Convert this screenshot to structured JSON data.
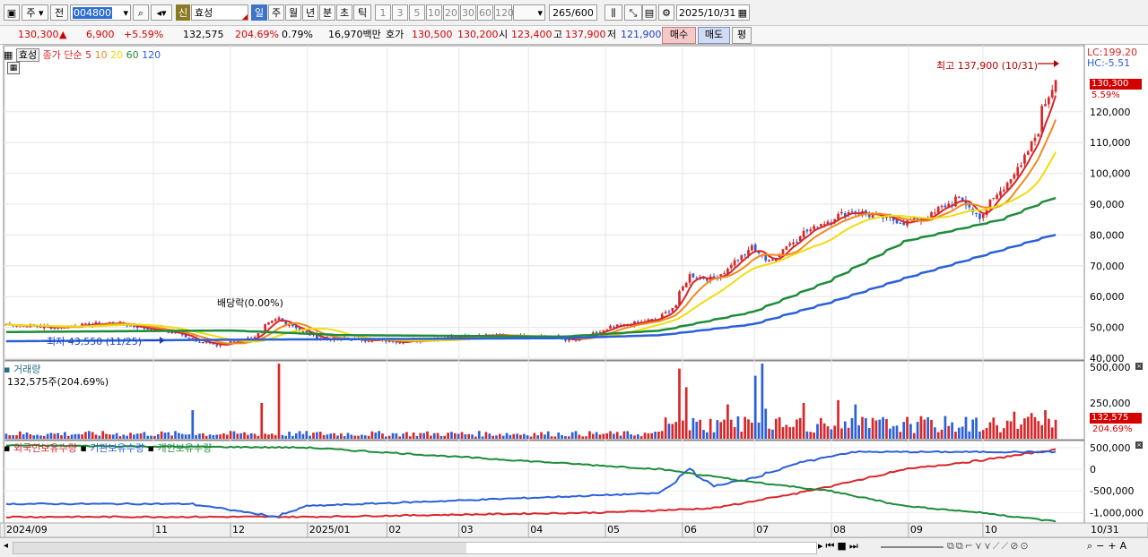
{
  "toolbar": {
    "period_week": "주",
    "prev": "전",
    "code": "004800",
    "stock_name": "효성",
    "badge_new": "신",
    "tabs": [
      "일",
      "주",
      "월",
      "년",
      "분",
      "초",
      "틱"
    ],
    "intervals": [
      "1",
      "3",
      "5",
      "10",
      "20",
      "30",
      "60",
      "120"
    ],
    "count_current": "265",
    "count_max": "/600",
    "date": "2025/10/31"
  },
  "quote": {
    "price": "130,300",
    "arrow": "▲",
    "change": "6,900",
    "change_pct": "+5.59%",
    "volume": "132,575",
    "volume_ratio": "204.69%",
    "turnover_rate": "0.79%",
    "amount": "16,970백만",
    "ask_label": "호가",
    "ask": "130,500",
    "bid": "130,200",
    "open_label": "시",
    "open": "123,400",
    "high_label": "고",
    "high": "137,900",
    "low_label": "저",
    "low": "121,900",
    "buy": "매수",
    "sell": "매도",
    "avg": "평"
  },
  "price_panel": {
    "name_box": "효성",
    "legend_prefix": "종가 단순",
    "ma_labels": [
      {
        "label": "5",
        "color": "#d8262a"
      },
      {
        "label": "10",
        "color": "#f08a1c"
      },
      {
        "label": "20",
        "color": "#f2dc10"
      },
      {
        "label": "60",
        "color": "#1e8c3a"
      },
      {
        "label": "120",
        "color": "#2b60d8"
      }
    ],
    "lc": "LC:199.20",
    "hc": "HC:-5.51",
    "high_annotation": "최고 137,900 (10/31)",
    "low_annotation": "최저 43,550 (11/25)",
    "dividend_annotation": "배당락(0.00%)",
    "current_price_tag": "130,300",
    "current_pct_tag": "5.59%"
  },
  "volume_panel": {
    "title": "거래량",
    "info": "132,575주(204.69%)",
    "tag_value": "132,575",
    "tag_pct": "204.69%"
  },
  "holdings_panel": {
    "labels": [
      "외국인보유수량",
      "기관보유수량",
      "개인보유수량"
    ],
    "colors": [
      "#d8262a",
      "#2b60d8",
      "#1e8c3a"
    ]
  },
  "chart_data": [
    {
      "type": "line",
      "title": "효성 일봉 (종가 단순 이동평균 5·10·20·60·120)",
      "x_start": "2024-09-02",
      "x_end": "2025-10-31",
      "x_ticks": [
        "2024/09",
        "11",
        "12",
        "2025/01",
        "02",
        "03",
        "04",
        "05",
        "06",
        "07",
        "08",
        "09",
        "10",
        "10/31"
      ],
      "ylim": [
        40000,
        140000
      ],
      "y_ticks": [
        "120,000",
        "110,000",
        "100,000",
        "90,000",
        "80,000",
        "70,000",
        "60,000",
        "50,000",
        "40,000"
      ],
      "close_anchors": [
        {
          "x": "2024-09-02",
          "y": 51000
        },
        {
          "x": "2024-09-20",
          "y": 50000
        },
        {
          "x": "2024-10-15",
          "y": 51500
        },
        {
          "x": "2024-11-10",
          "y": 48000
        },
        {
          "x": "2024-11-25",
          "y": 44000
        },
        {
          "x": "2024-12-10",
          "y": 46500
        },
        {
          "x": "2024-12-20",
          "y": 53000
        },
        {
          "x": "2025-01-05",
          "y": 46500
        },
        {
          "x": "2025-02-10",
          "y": 45500
        },
        {
          "x": "2025-03-10",
          "y": 47500
        },
        {
          "x": "2025-04-10",
          "y": 47000
        },
        {
          "x": "2025-04-20",
          "y": 45500
        },
        {
          "x": "2025-05-05",
          "y": 50000
        },
        {
          "x": "2025-05-25",
          "y": 53000
        },
        {
          "x": "2025-06-01",
          "y": 59000
        },
        {
          "x": "2025-06-05",
          "y": 67000
        },
        {
          "x": "2025-06-15",
          "y": 65500
        },
        {
          "x": "2025-07-01",
          "y": 76000
        },
        {
          "x": "2025-07-07",
          "y": 71000
        },
        {
          "x": "2025-07-20",
          "y": 80000
        },
        {
          "x": "2025-08-01",
          "y": 85000
        },
        {
          "x": "2025-08-10",
          "y": 88000
        },
        {
          "x": "2025-08-20",
          "y": 86000
        },
        {
          "x": "2025-09-01",
          "y": 84000
        },
        {
          "x": "2025-09-10",
          "y": 86000
        },
        {
          "x": "2025-09-22",
          "y": 92000
        },
        {
          "x": "2025-10-01",
          "y": 86000
        },
        {
          "x": "2025-10-10",
          "y": 95000
        },
        {
          "x": "2025-10-20",
          "y": 105000
        },
        {
          "x": "2025-10-28",
          "y": 123000
        },
        {
          "x": "2025-10-31",
          "y": 130300
        }
      ],
      "series": [
        {
          "name": "5",
          "color": "#d8262a"
        },
        {
          "name": "10",
          "color": "#f08a1c"
        },
        {
          "name": "20",
          "color": "#f2dc10"
        },
        {
          "name": "60",
          "color": "#1e8c3a",
          "values": [
            {
              "x": "2024-09-02",
              "y": 48500
            },
            {
              "x": "2024-12-01",
              "y": 49000
            },
            {
              "x": "2025-01-15",
              "y": 47500
            },
            {
              "x": "2025-04-15",
              "y": 47000
            },
            {
              "x": "2025-05-25",
              "y": 49000
            },
            {
              "x": "2025-07-01",
              "y": 55000
            },
            {
              "x": "2025-08-01",
              "y": 65000
            },
            {
              "x": "2025-09-01",
              "y": 78000
            },
            {
              "x": "2025-10-10",
              "y": 85000
            },
            {
              "x": "2025-10-31",
              "y": 92000
            }
          ]
        },
        {
          "name": "120",
          "color": "#2b60d8",
          "values": [
            {
              "x": "2024-09-02",
              "y": 45500
            },
            {
              "x": "2024-12-01",
              "y": 46000
            },
            {
              "x": "2025-04-15",
              "y": 46500
            },
            {
              "x": "2025-05-25",
              "y": 47500
            },
            {
              "x": "2025-07-01",
              "y": 51000
            },
            {
              "x": "2025-08-01",
              "y": 58000
            },
            {
              "x": "2025-09-01",
              "y": 66000
            },
            {
              "x": "2025-10-01",
              "y": 73000
            },
            {
              "x": "2025-10-31",
              "y": 80000
            }
          ]
        }
      ]
    },
    {
      "type": "bar",
      "title": "거래량",
      "ylim": [
        0,
        500000
      ],
      "y_ticks": [
        "500,000",
        "250,000"
      ],
      "spikes": [
        {
          "x": "2024-11-15",
          "y": 200000
        },
        {
          "x": "2024-12-13",
          "y": 250000
        },
        {
          "x": "2024-12-20",
          "y": 620000
        },
        {
          "x": "2025-06-02",
          "y": 490000
        },
        {
          "x": "2025-06-04",
          "y": 360000
        },
        {
          "x": "2025-06-20",
          "y": 240000
        },
        {
          "x": "2025-07-02",
          "y": 440000
        },
        {
          "x": "2025-07-04",
          "y": 610000
        },
        {
          "x": "2025-07-07",
          "y": 210000
        },
        {
          "x": "2025-07-22",
          "y": 250000
        },
        {
          "x": "2025-08-05",
          "y": 270000
        },
        {
          "x": "2025-08-12",
          "y": 240000
        },
        {
          "x": "2025-09-28",
          "y": 160000
        },
        {
          "x": "2025-10-15",
          "y": 190000
        },
        {
          "x": "2025-10-22",
          "y": 180000
        },
        {
          "x": "2025-10-28",
          "y": 200000
        },
        {
          "x": "2025-10-31",
          "y": 132575
        }
      ]
    },
    {
      "type": "line",
      "title": "보유수량",
      "ylim": [
        -1200000,
        600000
      ],
      "y_ticks": [
        "500,000",
        "0",
        "-500,000",
        "-1,000,000"
      ],
      "series": [
        {
          "name": "외국인보유수량",
          "color": "#d8262a",
          "values": [
            {
              "x": "2024-09-02",
              "y": -1100000
            },
            {
              "x": "2025-01-01",
              "y": -1100000
            },
            {
              "x": "2025-05-01",
              "y": -1000000
            },
            {
              "x": "2025-06-15",
              "y": -900000
            },
            {
              "x": "2025-07-15",
              "y": -600000
            },
            {
              "x": "2025-08-01",
              "y": -400000
            },
            {
              "x": "2025-09-01",
              "y": 0
            },
            {
              "x": "2025-10-01",
              "y": 200000
            },
            {
              "x": "2025-10-31",
              "y": 450000
            }
          ]
        },
        {
          "name": "기관보유수량",
          "color": "#2b60d8",
          "values": [
            {
              "x": "2024-09-02",
              "y": -800000
            },
            {
              "x": "2024-11-15",
              "y": -800000
            },
            {
              "x": "2024-12-20",
              "y": -1100000
            },
            {
              "x": "2025-01-01",
              "y": -850000
            },
            {
              "x": "2025-05-25",
              "y": -550000
            },
            {
              "x": "2025-06-05",
              "y": 0
            },
            {
              "x": "2025-06-15",
              "y": -400000
            },
            {
              "x": "2025-07-01",
              "y": -200000
            },
            {
              "x": "2025-07-20",
              "y": 150000
            },
            {
              "x": "2025-08-10",
              "y": 400000
            },
            {
              "x": "2025-10-31",
              "y": 400000
            }
          ]
        },
        {
          "name": "개인보유수량",
          "color": "#1e8c3a",
          "values": [
            {
              "x": "2024-09-02",
              "y": 550000
            },
            {
              "x": "2025-01-01",
              "y": 500000
            },
            {
              "x": "2025-05-25",
              "y": 0
            },
            {
              "x": "2025-07-01",
              "y": -300000
            },
            {
              "x": "2025-08-01",
              "y": -500000
            },
            {
              "x": "2025-09-01",
              "y": -850000
            },
            {
              "x": "2025-10-01",
              "y": -1000000
            },
            {
              "x": "2025-10-31",
              "y": -1200000
            }
          ]
        }
      ]
    }
  ]
}
